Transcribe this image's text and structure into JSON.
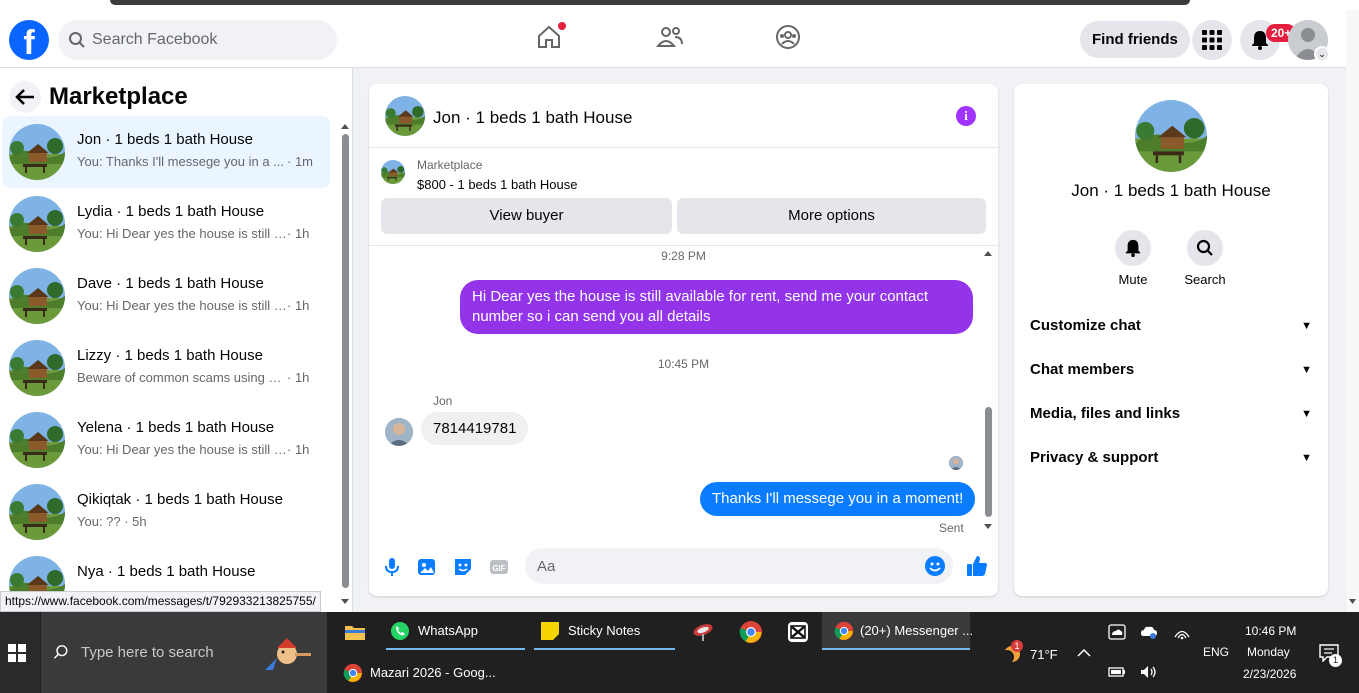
{
  "header": {
    "logo_letter": "f",
    "search_placeholder": "Search Facebook",
    "find_friends_label": "Find friends",
    "notif_badge": "20+"
  },
  "left": {
    "title": "Marketplace",
    "conversations": [
      {
        "name": "Jon · 1 beds 1 bath House",
        "snippet": "You: Thanks I'll messege you in a ...",
        "time": "· 1m",
        "active": true
      },
      {
        "name": "Lydia · 1 beds 1 bath House",
        "snippet": "You: Hi Dear yes the house is still a...",
        "time": "· 1h"
      },
      {
        "name": "Dave · 1 beds 1 bath House",
        "snippet": "You: Hi Dear yes the house is still a...",
        "time": "· 1h"
      },
      {
        "name": "Lizzy · 1 beds 1 bath House",
        "snippet": "Beware of common scams using pa...",
        "time": "· 1h"
      },
      {
        "name": "Yelena · 1 beds 1 bath House",
        "snippet": "You: Hi Dear yes the house is still a...",
        "time": "· 1h"
      },
      {
        "name": "Qikiqtak · 1 beds 1 bath House",
        "snippet": "You: ?? · 5h",
        "time": ""
      },
      {
        "name": "Nya · 1 beds 1 bath House",
        "snippet": "",
        "time": ""
      }
    ],
    "url_tooltip": "https://www.facebook.com/messages/t/792933213825755/"
  },
  "chat": {
    "title": "Jon · 1 beds 1 bath House",
    "marketplace_label": "Marketplace",
    "listing": "$800 - 1 beds 1 bath House",
    "view_buyer": "View buyer",
    "more_options": "More options",
    "ts1": "9:28 PM",
    "msg_out_1": "Hi Dear yes the house is still available for rent, send me your contact number so i can send you all details",
    "ts2": "10:45 PM",
    "sender_name": "Jon",
    "msg_in_1": "7814419781",
    "msg_out_2": "Thanks I'll messege you in a moment!",
    "sent_label": "Sent",
    "composer_placeholder": "Aa"
  },
  "right": {
    "title": "Jon · 1 beds 1 bath House",
    "mute_label": "Mute",
    "search_label": "Search",
    "rows": [
      "Customize chat",
      "Chat members",
      "Media, files and links",
      "Privacy & support"
    ]
  },
  "taskbar": {
    "search_placeholder": "Type here to search",
    "whatsapp": "WhatsApp",
    "sticky_notes": "Sticky Notes",
    "messenger": "(20+) Messenger ...",
    "mazari": "Mazari 2026 - Goog...",
    "weather_badge": "1",
    "temperature": "71°F",
    "language": "ENG",
    "time": "10:46 PM",
    "day": "Monday",
    "date": "2/23/2026",
    "notification_count": "1"
  },
  "colors": {
    "fb_blue": "#0866ff",
    "purple_bubble": "#9333ea",
    "blue_bubble": "#0a7cff",
    "badge_red": "#e41e3f"
  }
}
